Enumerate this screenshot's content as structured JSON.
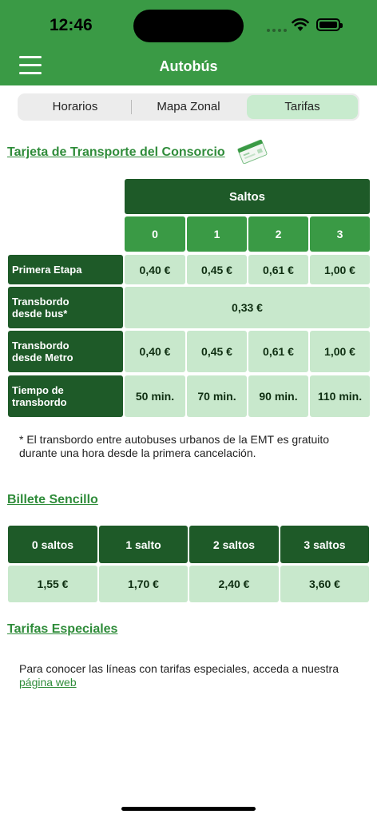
{
  "status": {
    "time": "12:46"
  },
  "header": {
    "title": "Autobús"
  },
  "tabs": [
    {
      "label": "Horarios",
      "active": false
    },
    {
      "label": "Mapa Zonal",
      "active": false
    },
    {
      "label": "Tarifas",
      "active": true
    }
  ],
  "consorcio": {
    "heading": "Tarjeta de Transporte del Consorcio",
    "saltos_label": "Saltos",
    "columns": [
      "0",
      "1",
      "2",
      "3"
    ],
    "rows": [
      {
        "label": "Primera Etapa",
        "values": [
          "0,40 €",
          "0,45 €",
          "0,61 €",
          "1,00 €"
        ]
      },
      {
        "label": "Transbordo\ndesde bus*",
        "merged": "0,33 €"
      },
      {
        "label": "Transbordo\ndesde Metro",
        "values": [
          "0,40 €",
          "0,45 €",
          "0,61 €",
          "1,00 €"
        ]
      },
      {
        "label": "Tiempo de\ntransbordo",
        "values": [
          "50 min.",
          "70 min.",
          "90 min.",
          "110 min."
        ]
      }
    ],
    "note": "* El transbordo entre autobuses urbanos de la EMT es gratuito durante una hora desde la primera cancelación."
  },
  "billete": {
    "heading": "Billete Sencillo",
    "headers": [
      "0 saltos",
      "1 salto",
      "2 saltos",
      "3 saltos"
    ],
    "prices": [
      "1,55 €",
      "1,70 €",
      "2,40 €",
      "3,60 €"
    ]
  },
  "especiales": {
    "heading": "Tarifas Especiales",
    "text": "Para conocer las líneas con tarifas especiales, acceda a nuestra",
    "link": "página web"
  }
}
